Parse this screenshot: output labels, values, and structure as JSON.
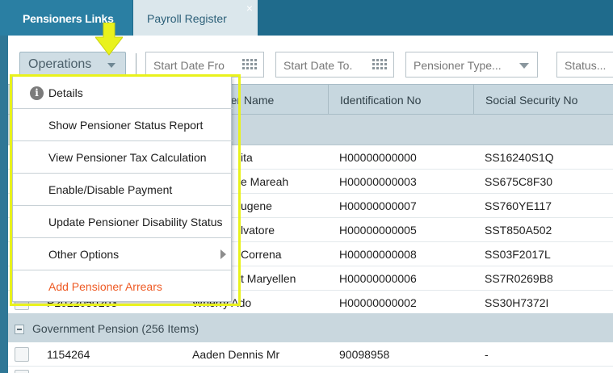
{
  "tabs": [
    {
      "label": "Pensioners Links",
      "active": true
    },
    {
      "label": "Payroll Register",
      "active": false,
      "close_glyph": "×"
    }
  ],
  "toolbar": {
    "operations_label": "Operations",
    "filters": [
      {
        "placeholder": "Start Date Fro",
        "icon": "calendar-icon"
      },
      {
        "placeholder": "Start Date To.",
        "icon": "calendar-icon"
      },
      {
        "placeholder": "Pensioner Type...",
        "icon": "chevron-down-icon"
      },
      {
        "placeholder": "Status...",
        "icon": "chevron-down-icon"
      }
    ]
  },
  "grid": {
    "columns": [
      "Pensioner Name",
      "Identification No",
      "Social Security No"
    ],
    "group1_rows": [
      {
        "id": "",
        "name": "ita",
        "ident": "H00000000000",
        "ssn": "SS16240S1Q"
      },
      {
        "id": "",
        "name": "e Mareah",
        "ident": "H00000000003",
        "ssn": "SS675C8F30"
      },
      {
        "id": "",
        "name": "ugene",
        "ident": "H00000000007",
        "ssn": "SS760YE117"
      },
      {
        "id": "",
        "name": "lvatore",
        "ident": "H00000000005",
        "ssn": "SST850A502"
      },
      {
        "id": "",
        "name": "Correna",
        "ident": "H00000000008",
        "ssn": "SS03F2017L"
      },
      {
        "id": "",
        "name": "t Maryellen",
        "ident": "H00000000006",
        "ssn": "SS7R0269B8"
      },
      {
        "id": "P2022050203",
        "name": "Wherry Ado",
        "ident": "H00000000002",
        "ssn": "SS30H7372I"
      }
    ],
    "group2_label": "Government Pension (256 Items)",
    "group2_rows": [
      {
        "id": "1154264",
        "name": "Aaden Dennis Mr",
        "ident": "90098958",
        "ssn": "-"
      }
    ]
  },
  "menu": {
    "items": [
      {
        "label": "Details",
        "icon": "info-icon"
      },
      {
        "label": "Show Pensioner Status Report"
      },
      {
        "label": "View Pensioner Tax Calculation"
      },
      {
        "label": "Enable/Disable Payment"
      },
      {
        "label": "Update Pensioner Disability Status"
      },
      {
        "label": "Other Options",
        "icon": "chevron-right-icon"
      },
      {
        "label": "Add Pensioner Arrears"
      }
    ]
  },
  "colors": {
    "header_blue": "#1f6b8c",
    "highlight_yellow": "#e9f21c",
    "arrears_orange": "#ee5a24"
  }
}
